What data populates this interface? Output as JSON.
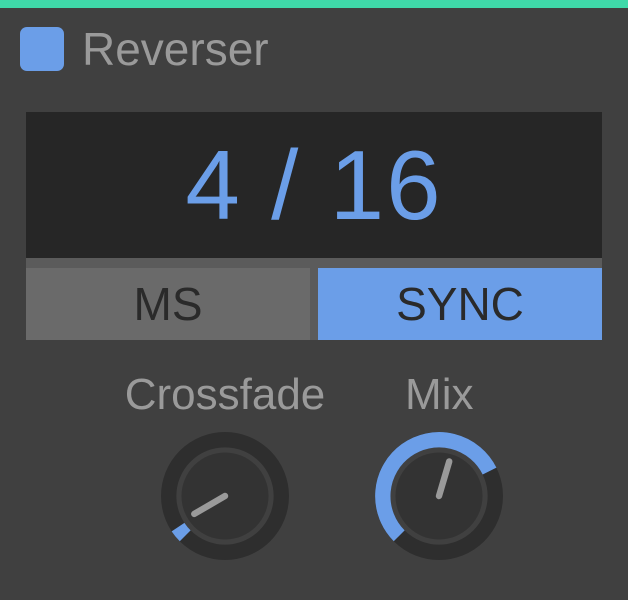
{
  "header": {
    "title": "Reverser"
  },
  "display": {
    "value": "4 / 16"
  },
  "modes": {
    "ms": "MS",
    "sync": "SYNC",
    "active": "sync"
  },
  "knobs": {
    "crossfade": {
      "label": "Crossfade",
      "value": 0.08
    },
    "mix": {
      "label": "Mix",
      "value": 0.78
    }
  },
  "colors": {
    "accent": "#6b9ee8",
    "top_bar": "#3fd9a9"
  }
}
